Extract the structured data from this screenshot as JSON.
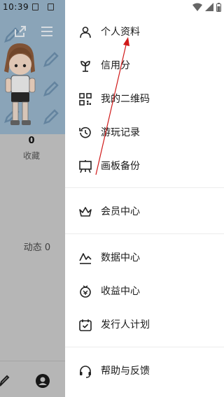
{
  "background": {
    "status_time": "10:39",
    "stat_count": "0",
    "stat_label": "收藏",
    "dynamic_label": "动态 0"
  },
  "drawer": {
    "group_one": [
      {
        "label": "个人资料",
        "icon": "person-icon"
      },
      {
        "label": "信用分",
        "icon": "sprout-icon"
      },
      {
        "label": "我的二维码",
        "icon": "qr-code-icon"
      },
      {
        "label": "游玩记录",
        "icon": "history-icon"
      },
      {
        "label": "画板备份",
        "icon": "easel-icon"
      }
    ],
    "group_two": [
      {
        "label": "会员中心",
        "icon": "crown-icon"
      }
    ],
    "group_three": [
      {
        "label": "数据中心",
        "icon": "chart-line-icon"
      },
      {
        "label": "收益中心",
        "icon": "coin-icon"
      },
      {
        "label": "发行人计划",
        "icon": "calendar-check-icon"
      }
    ],
    "group_four": [
      {
        "label": "帮助与反馈",
        "icon": "headset-icon"
      }
    ]
  },
  "colors": {
    "annotation_arrow": "#d01919",
    "overlay": "#c6c6c6",
    "blue_panel": "#96b2c8"
  }
}
